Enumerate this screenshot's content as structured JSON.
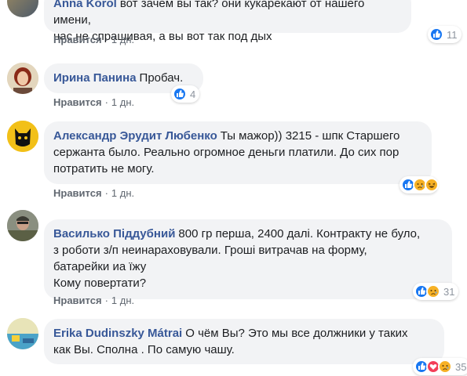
{
  "comments": [
    {
      "author": "Anna Korol",
      "lines": [
        "вот зачем вы так? они кукарекают от нашего имени,",
        "нас не спрашивая, а вы вот так под дых"
      ],
      "like_label": "Нравится",
      "time": "1 дн.",
      "reaction_count": "11",
      "reactions": [
        "like"
      ]
    },
    {
      "author": "Ирина Панина",
      "lines": [
        "Пробач."
      ],
      "like_label": "Нравится",
      "time": "1 дн.",
      "reaction_count": "4",
      "reactions": [
        "like"
      ]
    },
    {
      "author": "Александр Эрудит Любенко",
      "lines": [
        "Ты мажор)) 3215 - шпк Старшего",
        "сержанта было. Реально огромное деньги платили. До сих пор",
        "потратить не могу."
      ],
      "like_label": "Нравится",
      "time": "1 дн.",
      "reaction_count": "",
      "reactions": [
        "like",
        "sad",
        "haha"
      ]
    },
    {
      "author": "Василько Піддубний",
      "lines": [
        "800 гр перша, 2400 далі. Контракту не було,",
        "з роботи з/п неинараховували. Гроші витрачав на форму,",
        "батарейки иа їжу",
        "Кому повертати?"
      ],
      "like_label": "Нравится",
      "time": "1 дн.",
      "reaction_count": "31",
      "reactions": [
        "like",
        "sad"
      ]
    },
    {
      "author": "Erika Dudinszky Mátrai",
      "lines": [
        "О чём Вы? Это мы все должники у таких",
        "как Вы. Сполна . По самую чашу."
      ],
      "like_label": "",
      "time": "",
      "reaction_count": "35",
      "reactions": [
        "like",
        "love",
        "sad"
      ]
    }
  ],
  "sep": "·",
  "colors": {
    "author": "#385898",
    "bubble": "#f2f3f5",
    "like": "#1877f2",
    "love": "#f33e58",
    "sad": "#f7b125"
  }
}
